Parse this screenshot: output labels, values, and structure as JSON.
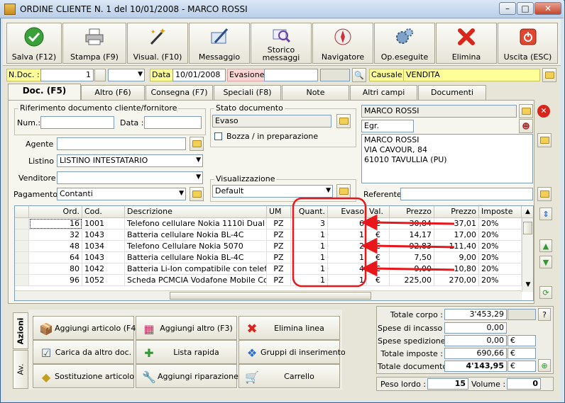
{
  "window": {
    "title": "ORDINE CLIENTE N. 1  del 10/01/2008 - MARCO ROSSI"
  },
  "toolbar": {
    "buttons": [
      {
        "label": "Salva (F12)",
        "icon": "save-check-icon"
      },
      {
        "label": "Stampa (F9)",
        "icon": "printer-icon"
      },
      {
        "label": "Visual. (F10)",
        "icon": "magic-wand-icon"
      },
      {
        "label": "Messaggio",
        "icon": "pen-letter-icon"
      },
      {
        "label": "Storico messaggi",
        "icon": "message-history-icon"
      },
      {
        "label": "Navigatore",
        "icon": "compass-icon"
      },
      {
        "label": "Op.eseguite",
        "icon": "gears-icon"
      },
      {
        "label": "Elimina",
        "icon": "delete-x-icon"
      },
      {
        "label": "Uscita (ESC)",
        "icon": "exit-icon"
      }
    ]
  },
  "header": {
    "ndoc_label": "N.Doc. :",
    "ndoc_value": "1",
    "data_label": "Data :",
    "data_value": "10/01/2008",
    "evasione_label": "Evasione:",
    "causale_label": "Causale :",
    "causale_value": "VENDITA"
  },
  "tabs": [
    "Doc. (F5)",
    "Altro (F6)",
    "Consegna (F7)",
    "Speciali (F8)",
    "Note",
    "Altri campi",
    "Documenti"
  ],
  "doc": {
    "rif_group": "Riferimento documento cliente/fornitore",
    "num_label": "Num.:",
    "data_label": "Data :",
    "stato_group": "Stato documento",
    "stato_value": "Evaso",
    "bozza_label": "Bozza / in preparazione",
    "agente_label": "Agente :",
    "listino_label": "Listino :",
    "listino_value": "LISTINO INTESTATARIO",
    "venditore_label": "Venditore :",
    "pagamento_label": "Pagamento :",
    "pagamento_value": "Contanti",
    "visual_group": "Visualizzazione",
    "visual_value": "Default",
    "cliente_name": "MARCO ROSSI",
    "cliente_title": "Egr.",
    "address_lines": [
      "MARCO ROSSI",
      "VIA CAVOUR, 84",
      "61010 TAVULLIA (PU)"
    ],
    "referente_label": "Referente"
  },
  "grid": {
    "columns": [
      "Ord.",
      "Cod.",
      "Descrizione",
      "UM",
      "Quant.",
      "Evaso",
      "Val.",
      "Prezzo",
      "Prezzo",
      "Imposte"
    ],
    "rows": [
      {
        "ord": "16",
        "cod": "1001",
        "desc": "Telefono cellulare Nokia 1110i Dual Ba...",
        "um": "PZ",
        "quant": "3",
        "evaso": "6",
        "val": "€",
        "prezzo": "30,84",
        "prezzo2": "37,01",
        "imposte": "20%"
      },
      {
        "ord": "32",
        "cod": "1043",
        "desc": "Batteria cellulare Nokia BL-4C",
        "um": "PZ",
        "quant": "1",
        "evaso": "1",
        "val": "€",
        "prezzo": "14,17",
        "prezzo2": "17,00",
        "imposte": "20%"
      },
      {
        "ord": "48",
        "cod": "1034",
        "desc": "Telefono Cellulare Nokia 5070",
        "um": "PZ",
        "quant": "1",
        "evaso": "2",
        "val": "€",
        "prezzo": "92,83",
        "prezzo2": "111,40",
        "imposte": "20%"
      },
      {
        "ord": "64",
        "cod": "1043",
        "desc": "Batteria cellulare Nokia BL-4C",
        "um": "PZ",
        "quant": "1",
        "evaso": "1",
        "val": "€",
        "prezzo": "7,50",
        "prezzo2": "9,00",
        "imposte": "20%"
      },
      {
        "ord": "80",
        "cod": "1042",
        "desc": "Batteria Li-Ion compatibile con telefoni ...",
        "um": "PZ",
        "quant": "1",
        "evaso": "4",
        "val": "€",
        "prezzo": "9,00",
        "prezzo2": "10,80",
        "imposte": "20%"
      },
      {
        "ord": "96",
        "cod": "1052",
        "desc": "Scheda PCMCIA Vodafone Mobile Con...",
        "um": "PZ",
        "quant": "1",
        "evaso": "1",
        "val": "€",
        "prezzo": "225,00",
        "prezzo2": "270,00",
        "imposte": "20%"
      }
    ]
  },
  "actions": {
    "vtab_azioni": "Azioni",
    "vtab_av": "Av.",
    "buttons": [
      {
        "label": "Aggiungi articolo (F4)",
        "icon": "add-box-icon"
      },
      {
        "label": "Aggiungi altro (F3)",
        "icon": "add-grid-icon"
      },
      {
        "label": "Elimina linea",
        "icon": "delete-x-icon"
      },
      {
        "label": "Carica da altro doc.",
        "icon": "checklist-icon"
      },
      {
        "label": "Lista rapida",
        "icon": "list-add-icon"
      },
      {
        "label": "Gruppi di inserimento",
        "icon": "group-add-icon"
      },
      {
        "label": "Sostituzione articolo",
        "icon": "swap-shapes-icon"
      },
      {
        "label": "Aggiungi riparazione",
        "icon": "wrench-icon"
      },
      {
        "label": "Carrello",
        "icon": "cart-icon"
      }
    ]
  },
  "totals": {
    "totale_corpo_label": "Totale corpo :",
    "totale_corpo": "3'453,29",
    "help": "?",
    "incasso_label": "Spese di incasso :",
    "incasso": "0,00",
    "spedizione_label": "Spese spedizione :",
    "spedizione": "0,00",
    "imposte_label": "Totale imposte :",
    "imposte": "690,66",
    "documento_label": "Totale documento :",
    "documento": "4'143,95",
    "currency": "€",
    "peso_label": "Peso lordo :",
    "peso": "15",
    "volume_label": "Volume :",
    "volume": "0"
  },
  "colors": {
    "highlight_red": "#e8171b",
    "yellow_field": "#ffff99",
    "pink_field": "#ffd6d6"
  }
}
